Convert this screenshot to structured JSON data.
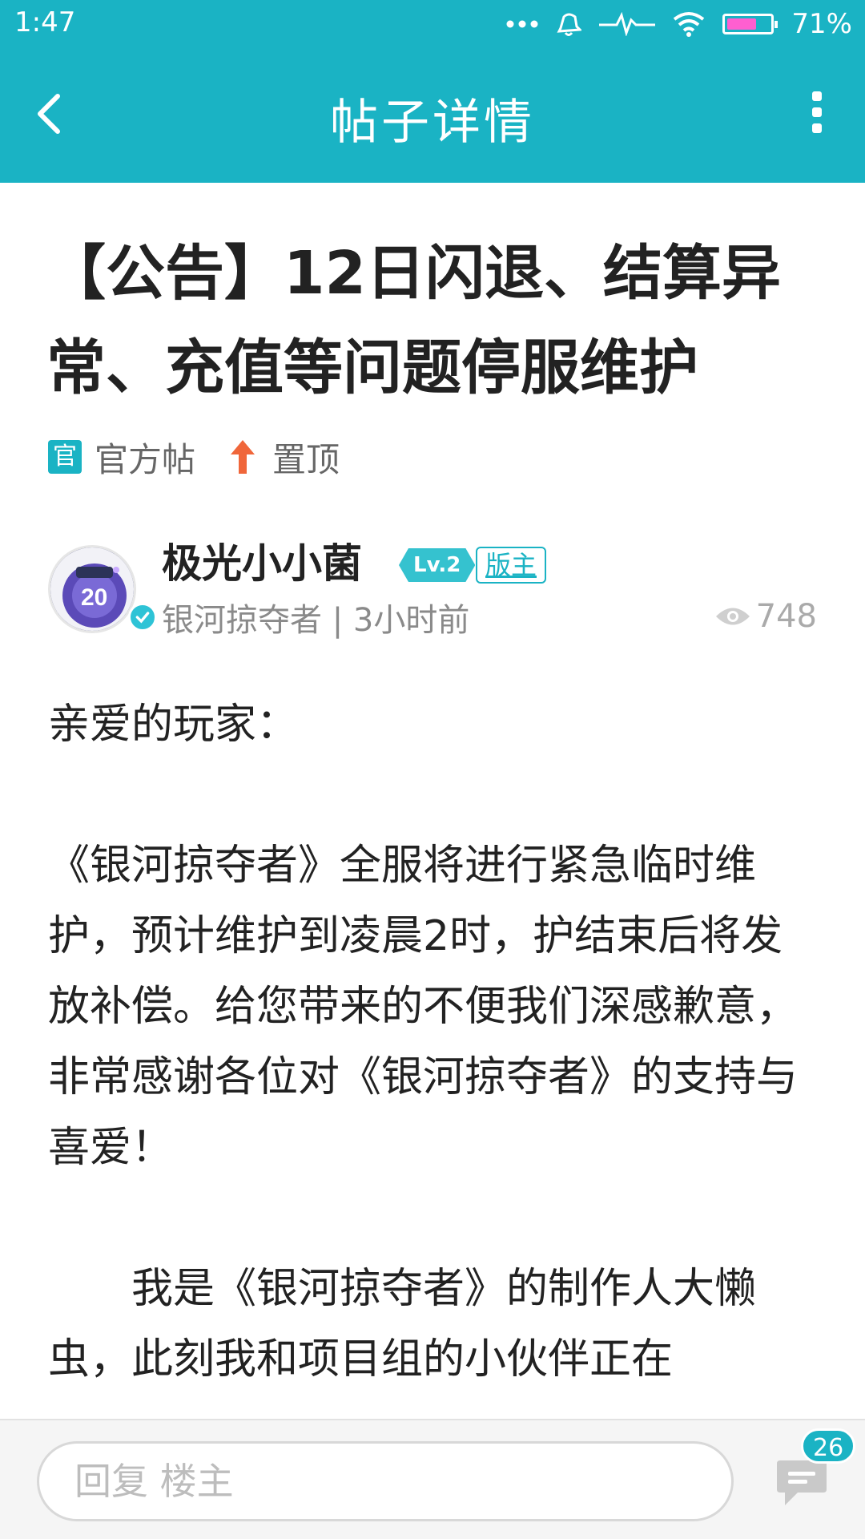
{
  "status_bar": {
    "time": "1:47",
    "battery_percent_text": "71%",
    "battery_level": 0.71,
    "icons": [
      "more-dots-icon",
      "alarm-icon",
      "signal-wave-icon",
      "wifi-icon",
      "battery-icon"
    ]
  },
  "app_bar": {
    "title": "帖子详情",
    "background_color": "#1ab3c4"
  },
  "post": {
    "title": "【公告】12日闪退、结算异常、充值等问题停服维护",
    "tags": {
      "official_icon_text": "官",
      "official_label": "官方帖",
      "pinned_label": "置顶"
    },
    "author": {
      "name": "极光小小菌",
      "level": "Lv.2",
      "role": "版主",
      "meta": "银河掠夺者 | 3小时前"
    },
    "views": "748",
    "body": {
      "greeting": "亲爱的玩家：",
      "paragraph_1": "《银河掠夺者》全服将进行紧急临时维护，预计维护到凌晨2时，护结束后将发放补偿。给您带来的不便我们深感歉意，非常感谢各位对《银河掠夺者》的支持与喜爱！",
      "paragraph_2": "我是《银河掠夺者》的制作人大懒虫，此刻我和项目组的小伙伴正在"
    }
  },
  "reply_bar": {
    "placeholder": "回复 楼主",
    "comment_count": "26"
  },
  "colors": {
    "accent": "#1ab3c4",
    "pin_arrow": "#f0663a",
    "battery_fill": "#ff5fd0"
  }
}
